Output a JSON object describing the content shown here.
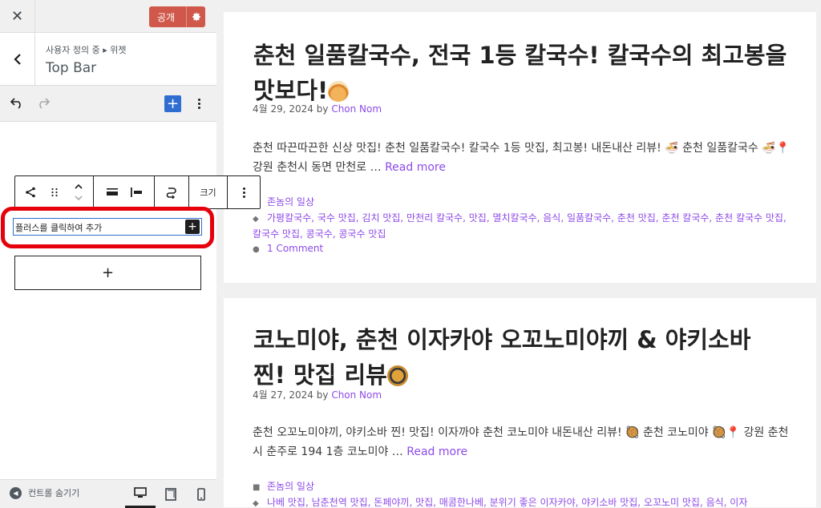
{
  "sidebar": {
    "close_label": "✕",
    "publish_label": "공개",
    "breadcrumb": "사용자 정의 중 ▸ 위젯",
    "section_title": "Top Bar",
    "block_toolbar": {
      "size_label": "크기"
    },
    "add_row_text": "플러스를 클릭하여 추가",
    "append_label": "+",
    "hide_controls_label": "컨트롤 숨기기"
  },
  "posts": [
    {
      "title": "춘천 일품칼국수, 전국 1등 칼국수! 칼국수의 최고봉을 맛보다!",
      "date": "4월 29, 2024",
      "by": "by",
      "author": "Chon Nom",
      "excerpt": "춘천 따끈따끈한 신상 맛집! 춘천 일품칼국수! 칼국수 1등 맛집, 최고봉! 내돈내산 리뷰! 🍜 춘천 일품칼국수 🍜📍 강원 춘천시 동면 만천로 …",
      "read_more": "Read more",
      "category": "존놈의 일상",
      "tags": "가평칼국수, 국수 맛집, 김치 맛집, 만천리 칼국수, 맛집, 멸치칼국수, 음식, 일품칼국수, 춘천 맛집, 춘천 칼국수, 춘천 칼국수 맛집, 칼국수 맛집, 콩국수, 콩국수 맛집",
      "comments": "1 Comment"
    },
    {
      "title": "코노미야, 춘천 이자카야 오꼬노미야끼 & 야키소바 찐! 맛집 리뷰",
      "date": "4월 27, 2024",
      "by": "by",
      "author": "Chon Nom",
      "excerpt": "춘천 오꼬노미야끼, 야키소바 찐! 맛집! 이자까야 춘천 코노미야 내돈내산 리뷰! 🥘 춘천 코노미야 🥘📍 강원 춘천시 춘주로 194 1층 코노미야 …",
      "read_more": "Read more",
      "category": "존놈의 일상",
      "tags": "나베 맛집, 남춘천역 맛집, 돈페야끼, 맛집, 매콤한나베, 분위기 좋은 이자카야, 야키소바 맛집, 오꼬노미 맛집, 음식, 이자"
    }
  ],
  "colors": {
    "accent": "#8d4ae8",
    "publish": "#d0584b",
    "highlight": "#e5000b",
    "inserter": "#2f6dd0"
  }
}
